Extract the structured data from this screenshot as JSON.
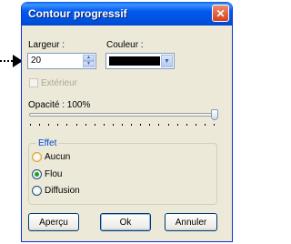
{
  "window": {
    "title": "Contour progressif",
    "close_label": "✕"
  },
  "width_field": {
    "label": "Largeur :",
    "value": "20"
  },
  "color_field": {
    "label": "Couleur :",
    "value": "#000000"
  },
  "exterior_checkbox": {
    "label": "Extérieur",
    "checked": false,
    "enabled": false
  },
  "opacity": {
    "label": "Opacité : 100%",
    "value_percent": 100
  },
  "effect_group": {
    "legend": "Effet",
    "options": [
      {
        "label": "Aucun",
        "selected": false
      },
      {
        "label": "Flou",
        "selected": true
      },
      {
        "label": "Diffusion",
        "selected": false
      }
    ]
  },
  "buttons": {
    "preview": "Aperçu",
    "ok": "Ok",
    "cancel": "Annuler"
  },
  "colors": {
    "title_bar": "#0054e3",
    "dialog_background": "#ece9d8",
    "group_legend": "#0046d5",
    "radio_selected_dot": "#21a121"
  }
}
